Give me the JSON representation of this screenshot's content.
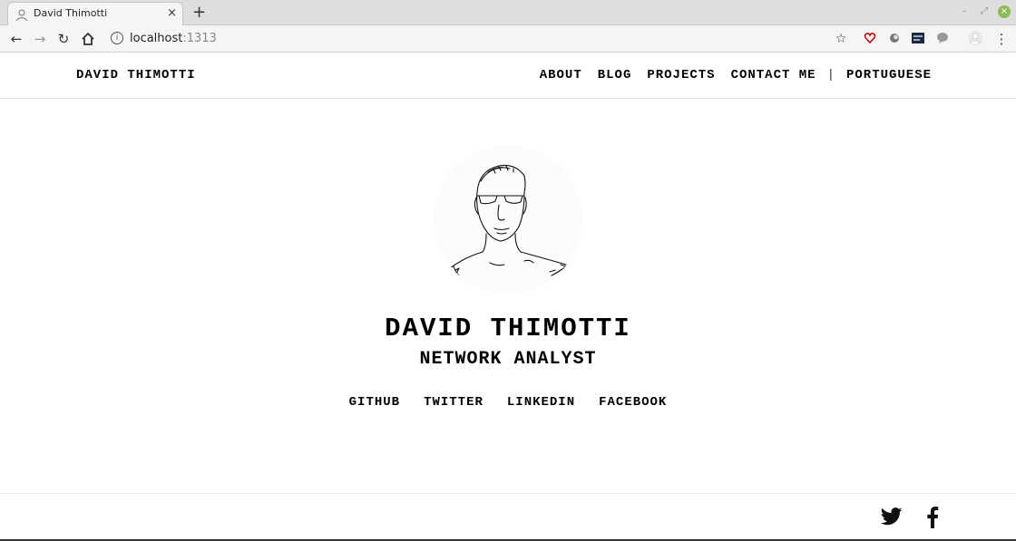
{
  "browser": {
    "tab_title": "David Thimotti",
    "tab_close": "×",
    "new_tab": "+",
    "url_host": "localhost",
    "url_port": ":1313",
    "win_minimize": "–",
    "win_maximize": "⤢",
    "win_close": "×"
  },
  "site": {
    "brand": "DAVID THIMOTTI",
    "menu": [
      "ABOUT",
      "BLOG",
      "PROJECTS",
      "CONTACT ME"
    ],
    "menu_separator": "|",
    "language": "PORTUGUESE"
  },
  "profile": {
    "name": "DAVID THIMOTTI",
    "role": "NETWORK ANALYST",
    "links": [
      "GITHUB",
      "TWITTER",
      "LINKEDIN",
      "FACEBOOK"
    ]
  },
  "footer": {
    "icons": [
      "twitter-icon",
      "facebook-icon"
    ]
  }
}
